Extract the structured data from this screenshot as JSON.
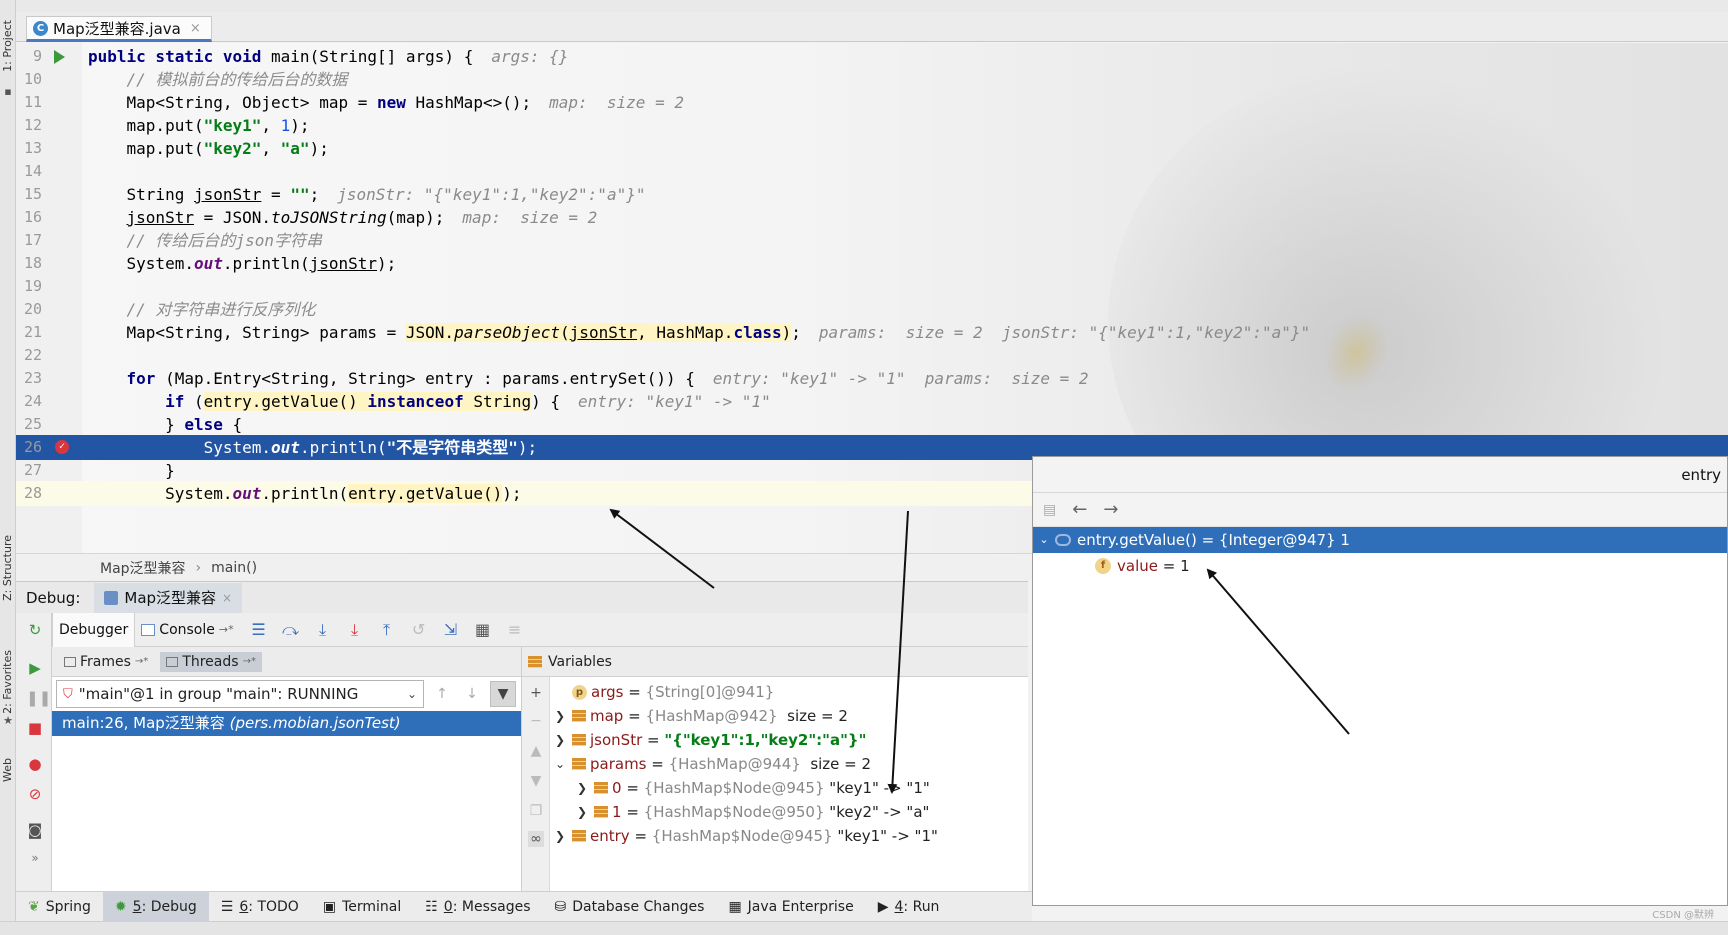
{
  "file_tab": {
    "label": "Map泛型兼容.java",
    "close": "×"
  },
  "left_strip": {
    "project": "1: Project",
    "structure": "Z: Structure",
    "favorites": "2: Favorites",
    "web": "Web"
  },
  "code": [
    {
      "n": "9"
    },
    {
      "n": "10"
    },
    {
      "n": "11"
    },
    {
      "n": "12"
    },
    {
      "n": "13"
    },
    {
      "n": "14"
    },
    {
      "n": "15"
    },
    {
      "n": "16"
    },
    {
      "n": "17"
    },
    {
      "n": "18"
    },
    {
      "n": "19"
    },
    {
      "n": "20"
    },
    {
      "n": "21"
    },
    {
      "n": "22"
    },
    {
      "n": "23"
    },
    {
      "n": "24"
    },
    {
      "n": "25"
    },
    {
      "n": "26"
    },
    {
      "n": "27"
    },
    {
      "n": "28"
    }
  ],
  "inline_hints": {
    "l9": "args: {}",
    "l11": "map:  size = 2",
    "l15": "jsonStr: \"{\"key1\":1,\"key2\":\"a\"}\"",
    "l16": "map:  size = 2",
    "l21": "params:  size = 2  jsonStr: \"{\"key1\":1,\"key2\":\"a\"}\"",
    "l23": "entry: \"key1\" -> \"1\"  params:  size = 2",
    "l24": "entry: \"key1\" -> \"1\""
  },
  "comments": {
    "l10": "// 模拟前台的传给后台的数据",
    "l17": "// 传给后台的json字符串",
    "l20": "// 对字符串进行反序列化"
  },
  "strings": {
    "key1": "\"key1\"",
    "key2": "\"key2\"",
    "a": "\"a\"",
    "empty": "\"\"",
    "not_string": "\"不是字符串类型\""
  },
  "breadcrumb": {
    "class": "Map泛型兼容",
    "method": "main()"
  },
  "debug": {
    "title": "Debug:",
    "tab": "Map泛型兼容",
    "debugger": "Debugger",
    "console": "Console",
    "frames": "Frames",
    "threads": "Threads",
    "thread_select": "\"main\"@1 in group \"main\": RUNNING",
    "frame_item": "main:26, Map泛型兼容",
    "frame_pkg": "(pers.mobian.jsonTest)",
    "variables": "Variables"
  },
  "variables": [
    {
      "name": "args",
      "type": "{String[0]@941}",
      "extra": ""
    },
    {
      "name": "map",
      "type": "{HashMap@942}",
      "extra": "size = 2"
    },
    {
      "name": "jsonStr",
      "type": "",
      "extra": "\"{\"key1\":1,\"key2\":\"a\"}\""
    },
    {
      "name": "params",
      "type": "{HashMap@944}",
      "extra": "size = 2"
    },
    {
      "name": "0",
      "type": "{HashMap$Node@945}",
      "extra": "\"key1\" -> \"1\""
    },
    {
      "name": "1",
      "type": "{HashMap$Node@950}",
      "extra": "\"key2\" -> \"a\""
    },
    {
      "name": "entry",
      "type": "{HashMap$Node@945}",
      "extra": "\"key1\" -> \"1\""
    }
  ],
  "popup": {
    "title": "entry",
    "selected": "entry.getValue() = {Integer@947} 1",
    "child_name": "value",
    "child_value": "= 1"
  },
  "bottom_tools": [
    {
      "key": "",
      "label": "Spring"
    },
    {
      "key": "5",
      "label": ": Debug"
    },
    {
      "key": "6",
      "label": ": TODO"
    },
    {
      "key": "",
      "label": "Terminal"
    },
    {
      "key": "0",
      "label": ": Messages"
    },
    {
      "key": "",
      "label": "Database Changes"
    },
    {
      "key": "",
      "label": "Java Enterprise"
    },
    {
      "key": "4",
      "label": ": Run"
    }
  ],
  "watermark": "CSDN @默辨"
}
